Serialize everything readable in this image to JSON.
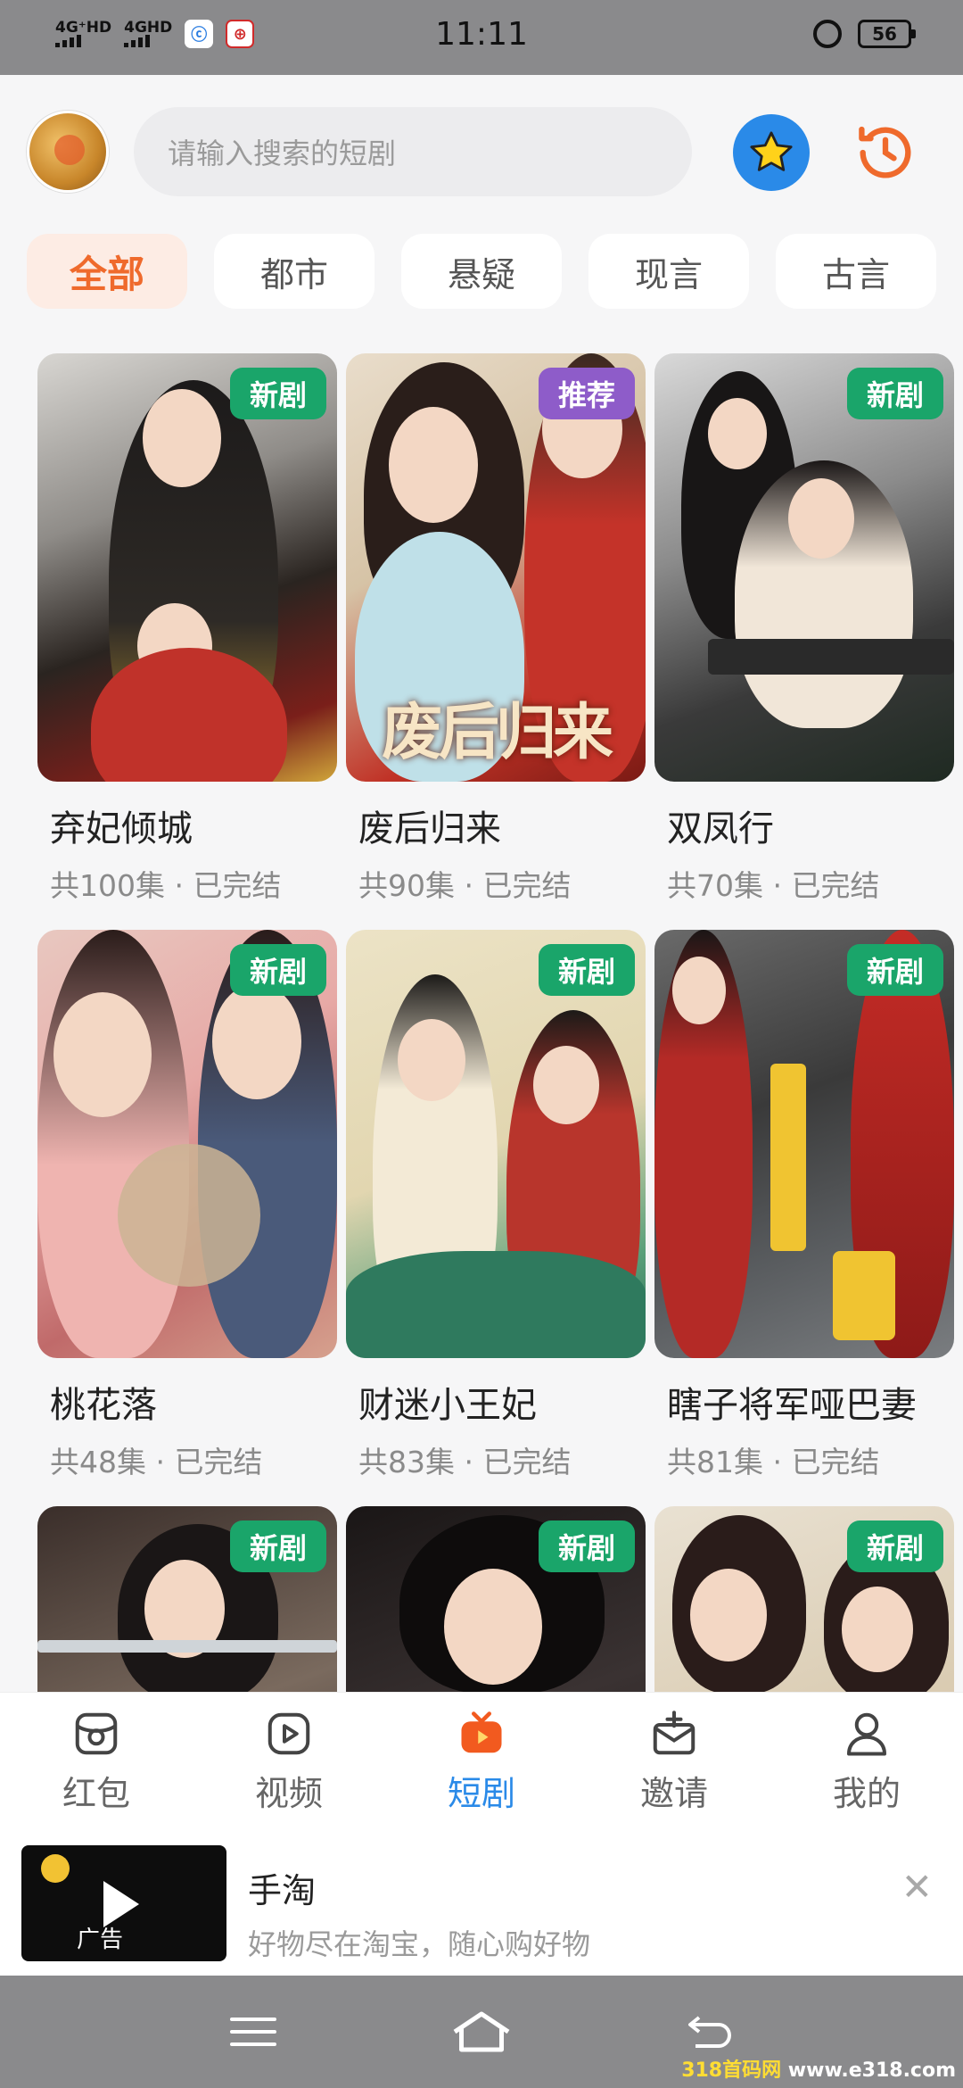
{
  "status_bar": {
    "time": "11:11",
    "signal1": "4G⁺HD",
    "signal2": "4GHD",
    "battery": "56"
  },
  "header": {
    "search_placeholder": "请输入搜索的短剧"
  },
  "tabs": [
    {
      "label": "全部",
      "active": true
    },
    {
      "label": "都市",
      "active": false
    },
    {
      "label": "悬疑",
      "active": false
    },
    {
      "label": "现言",
      "active": false
    },
    {
      "label": "古言",
      "active": false
    }
  ],
  "dramas": [
    {
      "title": "弃妃倾城",
      "meta": "共100集 · 已完结",
      "badge": "新剧",
      "poster_text": ""
    },
    {
      "title": "废后归来",
      "meta": "共90集 · 已完结",
      "badge": "推荐",
      "poster_text": "废后归来"
    },
    {
      "title": "双凤行",
      "meta": "共70集 · 已完结",
      "badge": "新剧",
      "poster_text": ""
    },
    {
      "title": "桃花落",
      "meta": "共48集 · 已完结",
      "badge": "新剧",
      "poster_text": ""
    },
    {
      "title": "财迷小王妃",
      "meta": "共83集 · 已完结",
      "badge": "新剧",
      "poster_text": ""
    },
    {
      "title": "瞎子将军哑巴妻",
      "meta": "共81集 · 已完结",
      "badge": "新剧",
      "poster_text": ""
    },
    {
      "title": "",
      "meta": "",
      "badge": "新剧",
      "poster_text": ""
    },
    {
      "title": "",
      "meta": "",
      "badge": "新剧",
      "poster_text": ""
    },
    {
      "title": "",
      "meta": "",
      "badge": "新剧",
      "poster_text": ""
    }
  ],
  "bottom_nav": [
    {
      "label": "红包",
      "icon": "red-packet-icon",
      "active": false
    },
    {
      "label": "视频",
      "icon": "video-icon",
      "active": false
    },
    {
      "label": "短剧",
      "icon": "tv-icon",
      "active": true
    },
    {
      "label": "邀请",
      "icon": "invite-icon",
      "active": false
    },
    {
      "label": "我的",
      "icon": "profile-icon",
      "active": false
    }
  ],
  "ad": {
    "title": "手淘",
    "subtitle": "好物尽在淘宝，随心购好物",
    "tag": "广告"
  },
  "watermark": {
    "a": "318首码网",
    "b": "www.e318.com"
  },
  "colors": {
    "accent": "#ef6a2c",
    "nav_active": "#2a8ae8",
    "badge_new": "#1aa56a",
    "badge_recommend": "#8e5cc9"
  }
}
